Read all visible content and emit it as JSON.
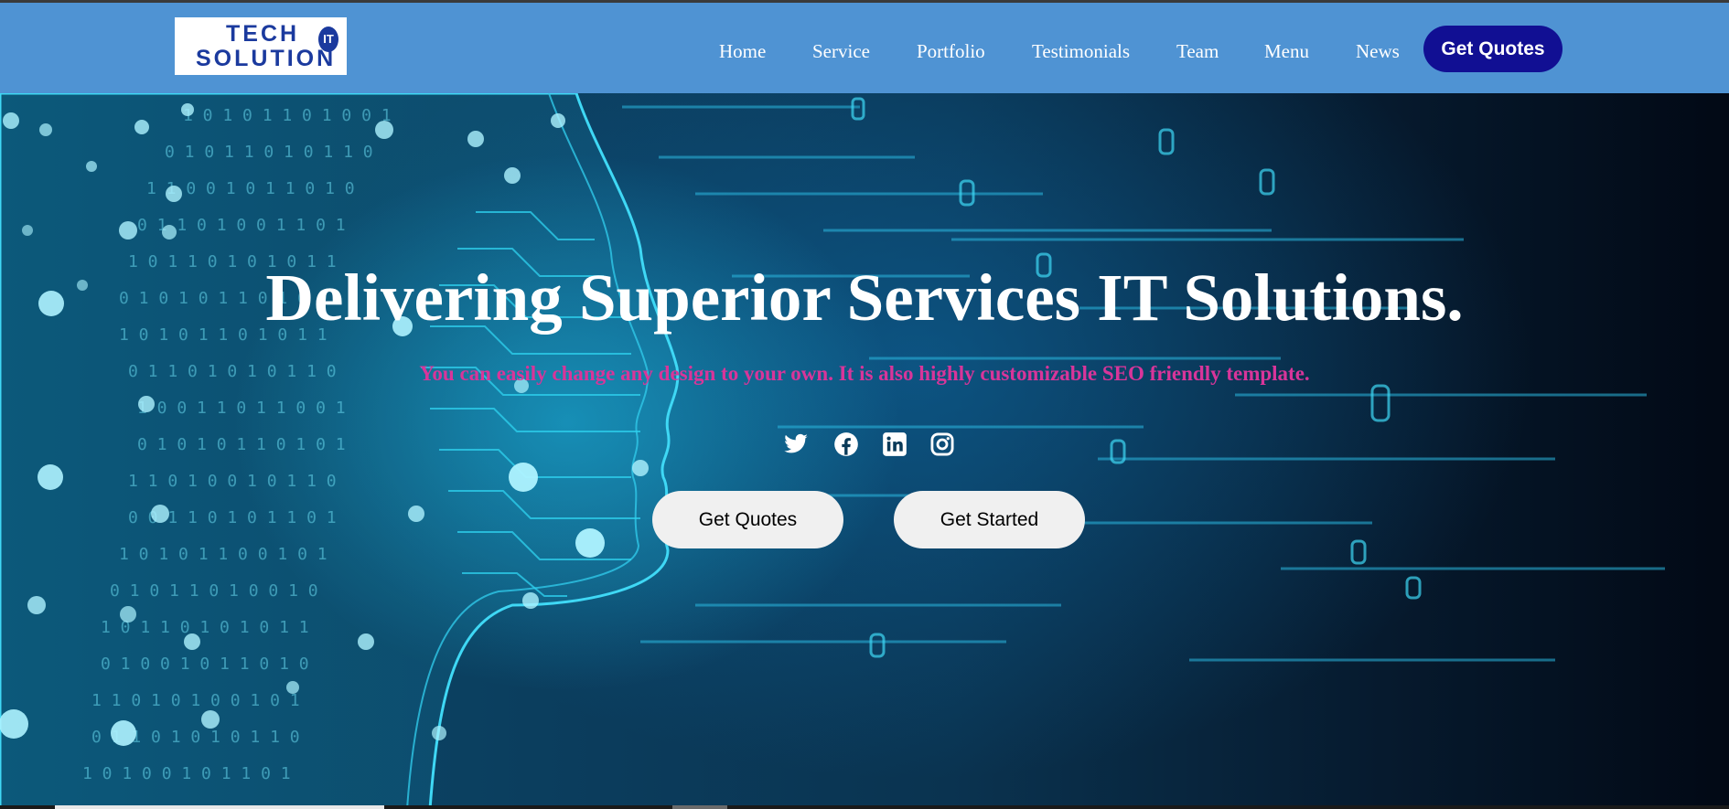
{
  "logo": {
    "line1": "TECH",
    "line2": "SOLUTION",
    "badge": "IT"
  },
  "nav": {
    "items": [
      "Home",
      "Service",
      "Portfolio",
      "Testimonials",
      "Team",
      "Menu",
      "News"
    ],
    "cta": "Get Quotes"
  },
  "hero": {
    "title": "Delivering Superior Services IT Solutions.",
    "subtitle": "You can easily change any design to your own. It is also highly customizable SEO friendly template.",
    "social_icons": [
      "twitter-icon",
      "facebook-icon",
      "linkedin-icon",
      "instagram-icon"
    ],
    "buttons": {
      "quotes": "Get Quotes",
      "started": "Get Started"
    }
  },
  "colors": {
    "navbar": "#4f93d3",
    "cta_bg": "#110f93",
    "subtitle": "#d8359a",
    "button_bg": "#f0f0f0",
    "circuit": "#2fd3f0"
  }
}
